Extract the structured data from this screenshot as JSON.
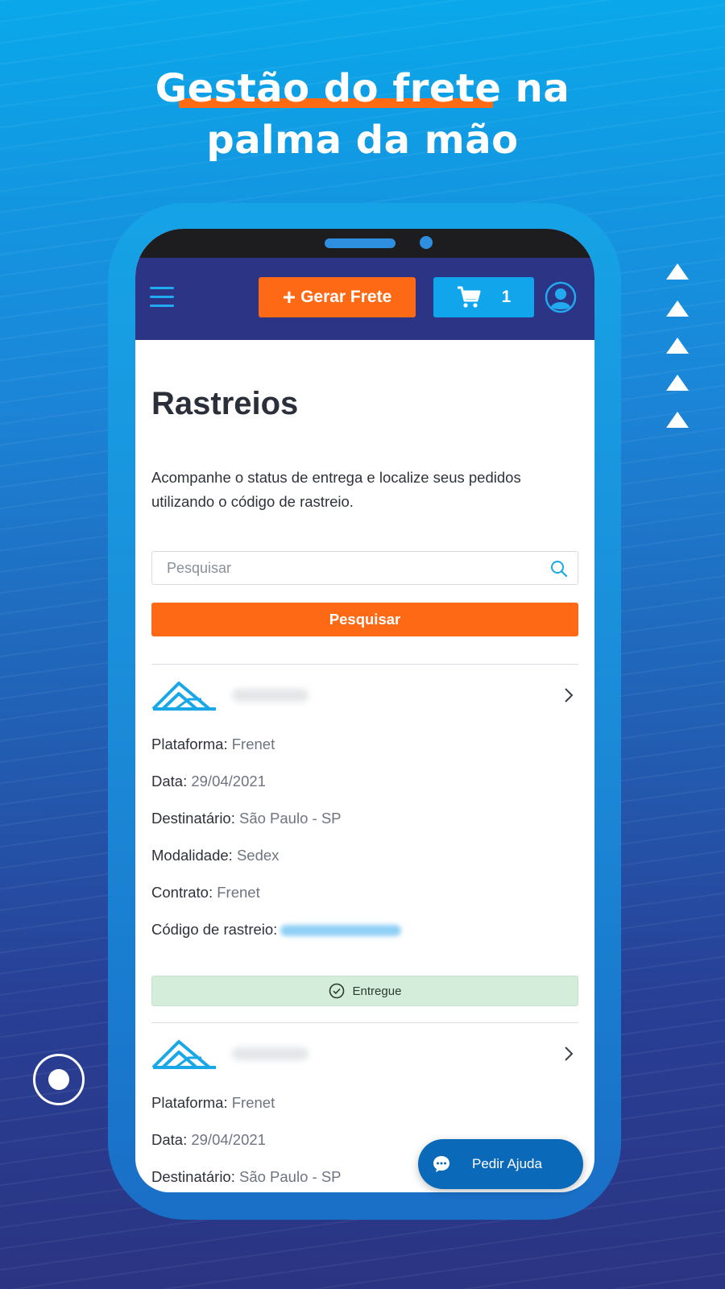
{
  "promo": {
    "headline_line1": "Gestão do frete na",
    "headline_line2": "palma da mão"
  },
  "app": {
    "header": {
      "generate_button": "Gerar Frete",
      "cart_count": "1"
    },
    "page_title": "Rastreios",
    "description": "Acompanhe o status de entrega e localize seus pedidos utilizando o código de rastreio.",
    "search": {
      "placeholder": "Pesquisar",
      "button_label": "Pesquisar"
    },
    "labels": {
      "platform": "Plataforma:",
      "date": "Data:",
      "recipient": "Destinatário:",
      "modality": "Modalidade:",
      "contract": "Contrato:",
      "tracking_code": "Código de rastreio:"
    },
    "shipments": [
      {
        "platform": "Frenet",
        "date": "29/04/2021",
        "recipient": "São Paulo - SP",
        "modality": "Sedex",
        "contract": "Frenet",
        "status": "Entregue"
      },
      {
        "platform": "Frenet",
        "date": "29/04/2021",
        "recipient": "São Paulo - SP"
      }
    ],
    "help_button": "Pedir Ajuda"
  },
  "colors": {
    "accent_orange": "#fe6915",
    "header_navy": "#2c3585",
    "cart_blue": "#11a6ec",
    "status_green_bg": "#d4eddb"
  }
}
